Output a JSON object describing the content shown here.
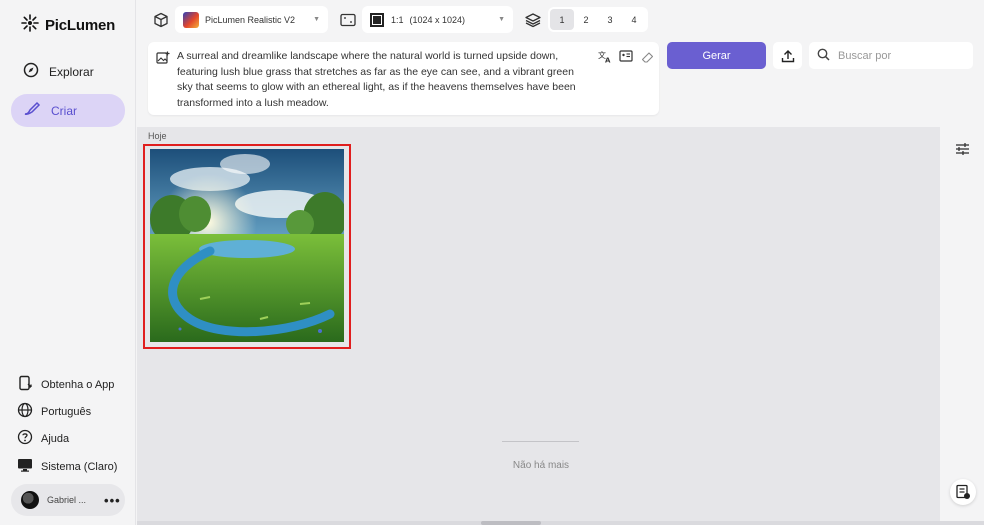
{
  "app": {
    "name": "PicLumen"
  },
  "sidebar": {
    "nav": [
      {
        "label": "Explorar",
        "icon": "compass-icon"
      },
      {
        "label": "Criar",
        "icon": "brush-icon",
        "active": true
      }
    ],
    "bottom": [
      {
        "label": "Obtenha o App",
        "icon": "download-app-icon"
      },
      {
        "label": "Português",
        "icon": "globe-icon"
      },
      {
        "label": "Ajuda",
        "icon": "help-icon"
      },
      {
        "label": "Sistema (Claro)",
        "icon": "monitor-icon"
      }
    ],
    "user": {
      "name": "Gabriel ..."
    }
  },
  "toolbar": {
    "model": "PicLumen Realistic V2",
    "aspect_ratio": "1:1",
    "resolution": "(1024 x 1024)",
    "counts": [
      "1",
      "2",
      "3",
      "4"
    ],
    "selected_count": "1"
  },
  "prompt": {
    "text": "A surreal and dreamlike landscape where the natural world is turned upside down, featuring lush blue grass that stretches as far as the eye can see, and a vibrant green sky that seems to glow with an ethereal light, as if the heavens themselves have been transformed into a lush meadow."
  },
  "actions": {
    "generate_label": "Gerar",
    "search_placeholder": "Buscar por"
  },
  "gallery": {
    "date_label": "Hoje",
    "end_text": "Não há mais"
  },
  "colors": {
    "accent": "#6a5fd1",
    "active_nav_bg": "#dcd4f6",
    "selection_border": "#e01e1e"
  }
}
